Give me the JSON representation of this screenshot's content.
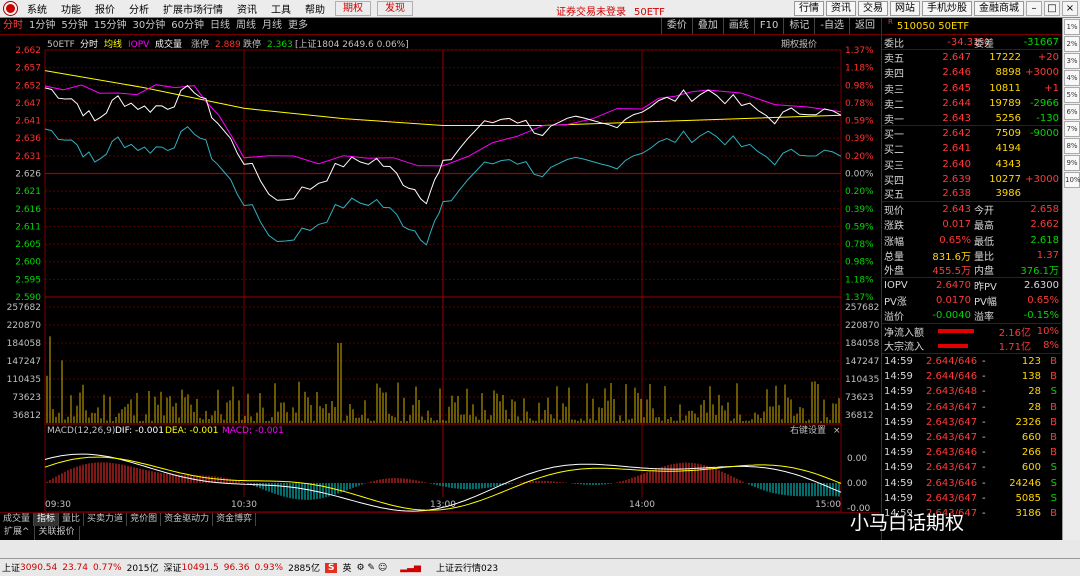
{
  "menubar": {
    "items": [
      "系统",
      "功能",
      "报价",
      "分析",
      "扩展市场行情",
      "资讯",
      "工具",
      "帮助"
    ],
    "red_items": [
      "期权",
      "发现"
    ],
    "notice": "证券交易未登录",
    "notice_code": "50ETF",
    "right_buttons": [
      "行情",
      "资讯",
      "交易",
      "网站",
      "手机炒股",
      "金融商城"
    ]
  },
  "toolbar": {
    "tabs": [
      "分时",
      "1分钟",
      "5分钟",
      "15分钟",
      "30分钟",
      "60分钟",
      "日线",
      "周线",
      "月线",
      "更多"
    ],
    "active_tab": "分时",
    "right": [
      "委价",
      "叠加",
      "画线",
      "F10",
      "标记",
      "-自选",
      "返回"
    ]
  },
  "chart": {
    "symbol": "50ETF",
    "legend": {
      "a": "分时",
      "b": "均线",
      "c": "IOPV",
      "d": "成交量",
      "e": "涨停",
      "f": "2.889",
      "g": "跌停",
      "h": "2.363",
      "i": "[上证1804 2649.6 0.06%]"
    },
    "option_quote_label": "期权报价",
    "macd_label": "MACD(12,26,9)",
    "macd_dif": "DIF: -0.001",
    "macd_dea": "DEA: -0.001",
    "macd_macd": "MACD: -0.001",
    "macd_settings": "右键设置",
    "macd_close": "×",
    "macd_ticks": [
      "0.00",
      "0.00",
      "-0.00"
    ],
    "price_ticks": [
      "2.662",
      "2.657",
      "2.652",
      "2.647",
      "2.641",
      "2.636",
      "2.631",
      "2.626",
      "2.621",
      "2.616",
      "2.611",
      "2.605",
      "2.600",
      "2.595",
      "2.590"
    ],
    "pct_ticks": [
      "1.37%",
      "1.18%",
      "0.98%",
      "0.78%",
      "0.59%",
      "0.39%",
      "0.20%",
      "0.00%",
      "0.20%",
      "0.39%",
      "0.59%",
      "0.78%",
      "0.98%",
      "1.18%",
      "1.37%"
    ],
    "vol_ticks": [
      "257682",
      "220870",
      "184058",
      "147247",
      "110435",
      "73623",
      "36812"
    ],
    "time_ticks": [
      "09:30",
      "10:30",
      "13:00",
      "14:00",
      "15:00"
    ],
    "colors": {
      "price": "#ffffff",
      "avg": "#ffff00",
      "iopv": "#ff00ff",
      "shifted": "#30b0c0",
      "up": "#ff3030",
      "down": "#00d8d8"
    }
  },
  "chart_data": {
    "type": "line",
    "title": "50ETF",
    "x_time_range": [
      "09:30",
      "15:00"
    ],
    "ylim": [
      2.59,
      2.662
    ],
    "prev_close": 2.626,
    "series": [
      {
        "name": "分时",
        "points": [
          [
            0,
            2.651
          ],
          [
            8,
            2.648
          ],
          [
            15,
            2.641
          ],
          [
            22,
            2.648
          ],
          [
            30,
            2.645
          ],
          [
            37,
            2.646
          ],
          [
            45,
            2.651
          ],
          [
            52,
            2.641
          ],
          [
            60,
            2.63
          ],
          [
            70,
            2.618
          ],
          [
            80,
            2.622
          ],
          [
            90,
            2.629
          ],
          [
            100,
            2.63
          ],
          [
            108,
            2.624
          ],
          [
            115,
            2.619
          ],
          [
            120,
            2.628
          ],
          [
            130,
            2.639
          ],
          [
            140,
            2.643
          ],
          [
            150,
            2.638
          ],
          [
            160,
            2.641
          ],
          [
            170,
            2.64
          ],
          [
            180,
            2.645
          ],
          [
            190,
            2.648
          ],
          [
            200,
            2.65
          ],
          [
            210,
            2.646
          ],
          [
            220,
            2.642
          ],
          [
            230,
            2.645
          ],
          [
            240,
            2.643
          ]
        ]
      },
      {
        "name": "均线",
        "points": [
          [
            0,
            2.656
          ],
          [
            30,
            2.651
          ],
          [
            60,
            2.645
          ],
          [
            90,
            2.642
          ],
          [
            120,
            2.64
          ],
          [
            150,
            2.64
          ],
          [
            180,
            2.641
          ],
          [
            210,
            2.642
          ],
          [
            240,
            2.643
          ]
        ]
      },
      {
        "name": "IOPV",
        "points": [
          [
            0,
            2.652
          ],
          [
            22,
            2.649
          ],
          [
            45,
            2.652
          ],
          [
            60,
            2.631
          ],
          [
            90,
            2.63
          ],
          [
            120,
            2.629
          ],
          [
            150,
            2.639
          ],
          [
            180,
            2.646
          ],
          [
            200,
            2.651
          ],
          [
            240,
            2.644
          ]
        ]
      }
    ]
  },
  "panel": {
    "code": "510050",
    "name": "50ETF",
    "webi_label": "委比",
    "webi": "-34.31%",
    "weicha_label": "委差",
    "weicha": "-31667",
    "asks": [
      {
        "label": "卖五",
        "price": "2.647",
        "vol": "17222",
        "chg": "+20"
      },
      {
        "label": "卖四",
        "price": "2.646",
        "vol": "8898",
        "chg": "+3000"
      },
      {
        "label": "卖三",
        "price": "2.645",
        "vol": "10811",
        "chg": "+1"
      },
      {
        "label": "卖二",
        "price": "2.644",
        "vol": "19789",
        "chg": "-2966"
      },
      {
        "label": "卖一",
        "price": "2.643",
        "vol": "5256",
        "chg": "-130"
      }
    ],
    "bids": [
      {
        "label": "买一",
        "price": "2.642",
        "vol": "7509",
        "chg": "-9000"
      },
      {
        "label": "买二",
        "price": "2.641",
        "vol": "4194",
        "chg": ""
      },
      {
        "label": "买三",
        "price": "2.640",
        "vol": "4343",
        "chg": ""
      },
      {
        "label": "买四",
        "price": "2.639",
        "vol": "10277",
        "chg": "+3000"
      },
      {
        "label": "买五",
        "price": "2.638",
        "vol": "3986",
        "chg": ""
      }
    ],
    "stats": [
      {
        "l1": "现价",
        "v1": "2.643",
        "c1": "r",
        "l2": "今开",
        "v2": "2.658",
        "c2": "r"
      },
      {
        "l1": "涨跌",
        "v1": "0.017",
        "c1": "r",
        "l2": "最高",
        "v2": "2.662",
        "c2": "r"
      },
      {
        "l1": "涨幅",
        "v1": "0.65%",
        "c1": "r",
        "l2": "最低",
        "v2": "2.618",
        "c2": "g"
      },
      {
        "l1": "总量",
        "v1": "831.6万",
        "c1": "y",
        "l2": "量比",
        "v2": "1.37",
        "c2": "r"
      },
      {
        "l1": "外盘",
        "v1": "455.5万",
        "c1": "r",
        "l2": "内盘",
        "v2": "376.1万",
        "c2": "g"
      }
    ],
    "iopv": [
      {
        "l1": "IOPV",
        "v1": "2.6470",
        "c1": "r",
        "l2": "昨PV",
        "v2": "2.6300",
        "c2": "w"
      },
      {
        "l1": "PV涨",
        "v1": "0.0170",
        "c1": "r",
        "l2": "PV幅",
        "v2": "0.65%",
        "c2": "r"
      },
      {
        "l1": "溢价",
        "v1": "-0.0040",
        "c1": "g",
        "l2": "溢率",
        "v2": "-0.15%",
        "c2": "g"
      }
    ],
    "flows": [
      {
        "label": "净流入额",
        "value": "2.16亿",
        "pct": "10%"
      },
      {
        "label": "大宗流入",
        "value": "1.71亿",
        "pct": "8%"
      }
    ],
    "ticks": [
      {
        "t": "14:59",
        "p": "2.644/646",
        "d": "-",
        "v": "123",
        "s": "B",
        "sc": "r"
      },
      {
        "t": "14:59",
        "p": "2.644/646",
        "d": "-",
        "v": "138",
        "s": "B",
        "sc": "r"
      },
      {
        "t": "14:59",
        "p": "2.643/648",
        "d": "-",
        "v": "28",
        "s": "S",
        "sc": "g"
      },
      {
        "t": "14:59",
        "p": "2.643/647",
        "d": "-",
        "v": "28",
        "s": "B",
        "sc": "r"
      },
      {
        "t": "14:59",
        "p": "2.643/647",
        "d": "-",
        "v": "2326",
        "s": "B",
        "sc": "r"
      },
      {
        "t": "14:59",
        "p": "2.643/647",
        "d": "-",
        "v": "660",
        "s": "B",
        "sc": "r"
      },
      {
        "t": "14:59",
        "p": "2.643/646",
        "d": "-",
        "v": "266",
        "s": "B",
        "sc": "r"
      },
      {
        "t": "14:59",
        "p": "2.643/647",
        "d": "-",
        "v": "600",
        "s": "S",
        "sc": "g"
      },
      {
        "t": "14:59",
        "p": "2.643/646",
        "d": "-",
        "v": "24246",
        "s": "S",
        "sc": "g"
      },
      {
        "t": "14:59",
        "p": "2.643/647",
        "d": "-",
        "v": "5085",
        "s": "S",
        "sc": "g"
      },
      {
        "t": "14:59",
        "p": "2.643/647",
        "d": "-",
        "v": "3186",
        "s": "B",
        "sc": "r"
      }
    ]
  },
  "bottom_tabs": [
    "成交量",
    "指标",
    "量比",
    "买卖力道",
    "竞价图",
    "资金驱动力",
    "资金博弈"
  ],
  "bottom_tabs_active": "指标",
  "bottom_tabs2": [
    "扩展^",
    "关联报价"
  ],
  "status": {
    "sh_label": "上证",
    "sh_val": "3090.54",
    "sh_chg": "23.74",
    "sh_pct": "0.77%",
    "sh_amt": "2015亿",
    "sz_label": "深证",
    "sz_val": "10491.5",
    "sz_chg": "96.36",
    "sz_pct": "0.93%",
    "sz_amt": "2885亿",
    "ime": "英",
    "cloud": "上证云行情023"
  },
  "watermark": "小马白话期权",
  "rstrip": [
    "1%",
    "2%",
    "3%",
    "4%",
    "5%",
    "6%",
    "7%",
    "8%",
    "9%",
    "10%"
  ]
}
